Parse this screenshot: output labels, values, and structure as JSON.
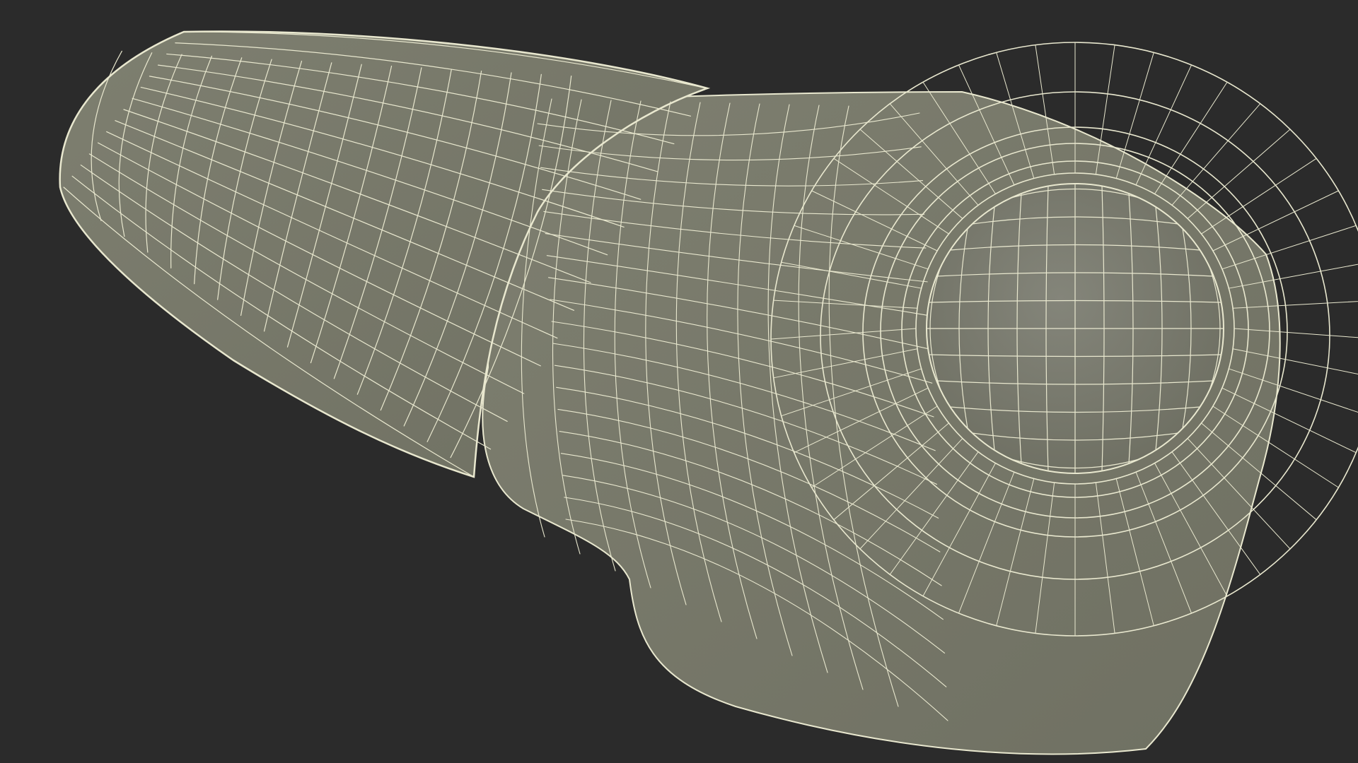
{
  "scene": {
    "subject": "wireframe-mesh",
    "colors": {
      "background": "#2b2b2b",
      "surface": "#777868",
      "surface_dark": "#6a6b5d",
      "surface_light": "#85867a",
      "wire": "#e9e8cf"
    }
  }
}
